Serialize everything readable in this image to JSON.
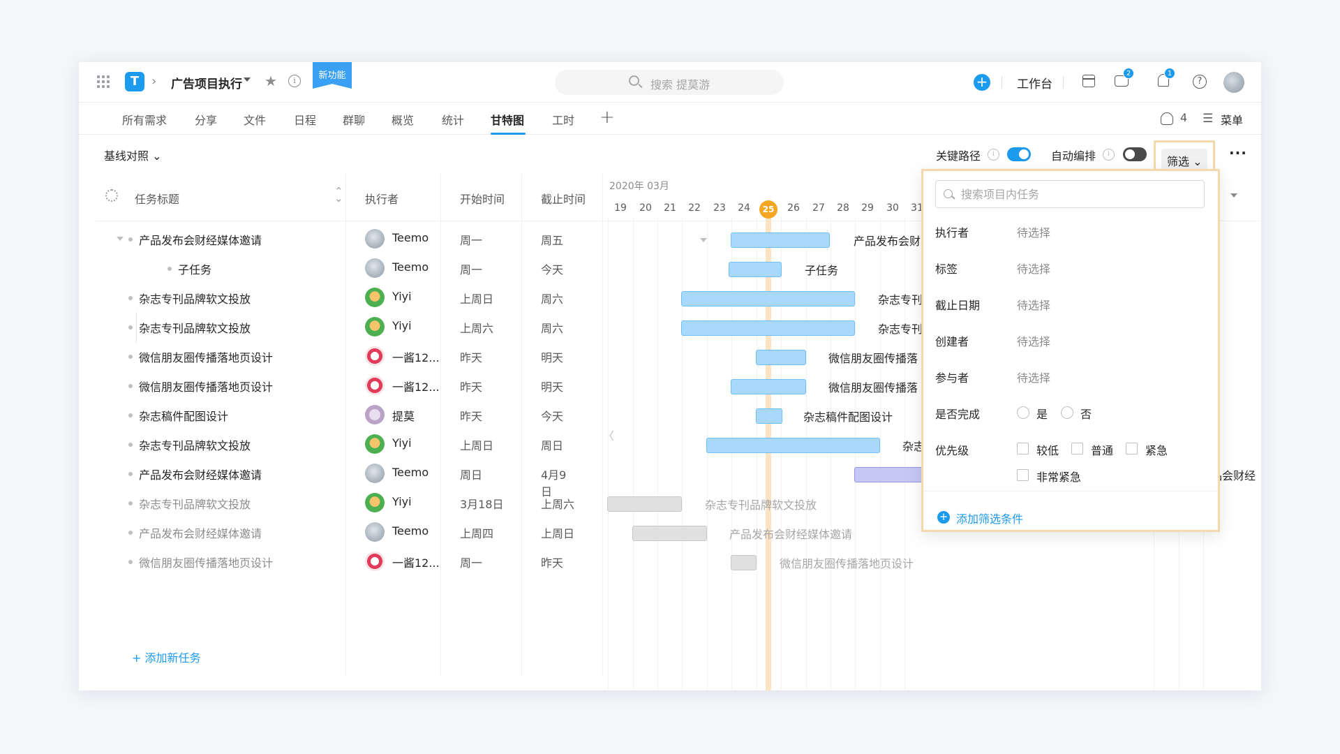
{
  "header": {
    "logo": "T",
    "project_name": "广告项目执行",
    "new_feature_badge": "新功能",
    "search_placeholder": "搜索 提莫游",
    "workbench": "工作台",
    "messages_badge": "2",
    "notifications_badge": "1",
    "help": "?",
    "info": "i"
  },
  "tabs": [
    {
      "label": "所有需求"
    },
    {
      "label": "分享"
    },
    {
      "label": "文件"
    },
    {
      "label": "日程"
    },
    {
      "label": "群聊"
    },
    {
      "label": "概览"
    },
    {
      "label": "统计"
    },
    {
      "label": "甘特图",
      "active": true
    },
    {
      "label": "工时"
    }
  ],
  "tab_add": "+",
  "members": {
    "count": "4"
  },
  "menu_label": "菜单",
  "toolbar": {
    "baseline": "基线对照",
    "critical_path": "关键路径",
    "auto_schedule": "自动编排",
    "filter": "筛选",
    "more": "···"
  },
  "table": {
    "columns": [
      "任务标题",
      "执行者",
      "开始时间",
      "截止时间"
    ],
    "rows": [
      {
        "title": "产品发布会财经媒体邀请",
        "assignee": "Teemo",
        "start": "周一",
        "end": "周五"
      },
      {
        "title": "子任务",
        "assignee": "Teemo",
        "start": "周一",
        "end": "今天"
      },
      {
        "title": "杂志专刊品牌软文投放",
        "assignee": "Yiyi",
        "start": "上周日",
        "end": "周六"
      },
      {
        "title": "杂志专刊品牌软文投放",
        "assignee": "Yiyi",
        "start": "上周六",
        "end": "周六"
      },
      {
        "title": "微信朋友圈传播落地页设计",
        "assignee": "一酱12...",
        "start": "昨天",
        "end": "明天"
      },
      {
        "title": "微信朋友圈传播落地页设计",
        "assignee": "一酱12...",
        "start": "昨天",
        "end": "明天"
      },
      {
        "title": "杂志稿件配图设计",
        "assignee": "提莫",
        "start": "昨天",
        "end": "今天"
      },
      {
        "title": "杂志专刊品牌软文投放",
        "assignee": "Yiyi",
        "start": "上周日",
        "end": "周日"
      },
      {
        "title": "产品发布会财经媒体邀请",
        "assignee": "Teemo",
        "start": "周日",
        "end": "4月9日"
      },
      {
        "title": "杂志专刊品牌软文投放",
        "assignee": "Yiyi",
        "start": "3月18日",
        "end": "上周六"
      },
      {
        "title": "产品发布会财经媒体邀请",
        "assignee": "Teemo",
        "start": "上周四",
        "end": "上周日"
      },
      {
        "title": "微信朋友圈传播落地页设计",
        "assignee": "一酱12...",
        "start": "周一",
        "end": "昨天"
      }
    ],
    "add_task": "+ 添加新任务"
  },
  "gantt": {
    "month": "2020年 03月",
    "days": [
      "19",
      "20",
      "21",
      "22",
      "23",
      "24",
      "25",
      "26",
      "27",
      "28",
      "29",
      "30",
      "31"
    ],
    "today": "25",
    "bar_labels": [
      "产品发布会财",
      "子任务",
      "杂志专刊",
      "杂志专刊",
      "微信朋友圈传播落",
      "微信朋友圈传播落",
      "杂志稿件配图设计",
      "杂志",
      "品会财经",
      "杂志专刊品牌软文投放",
      "产品发布会财经媒体邀请",
      "微信朋友圈传播落地页设计"
    ]
  },
  "filter_panel": {
    "search_placeholder": "搜索项目内任务",
    "fields": [
      {
        "label": "执行者",
        "value": "待选择"
      },
      {
        "label": "标签",
        "value": "待选择"
      },
      {
        "label": "截止日期",
        "value": "待选择"
      },
      {
        "label": "创建者",
        "value": "待选择"
      },
      {
        "label": "参与者",
        "value": "待选择"
      }
    ],
    "completion_label": "是否完成",
    "completion_options": [
      "是",
      "否"
    ],
    "priority_label": "优先级",
    "priority_options": [
      "较低",
      "普通",
      "紧急",
      "非常紧急"
    ],
    "add_condition": "添加筛选条件"
  },
  "colors": {
    "accent": "#1b9aee",
    "today": "#f5a623",
    "bar_fill": "#a8d8fb",
    "highlight_border": "#f5d9ae"
  }
}
